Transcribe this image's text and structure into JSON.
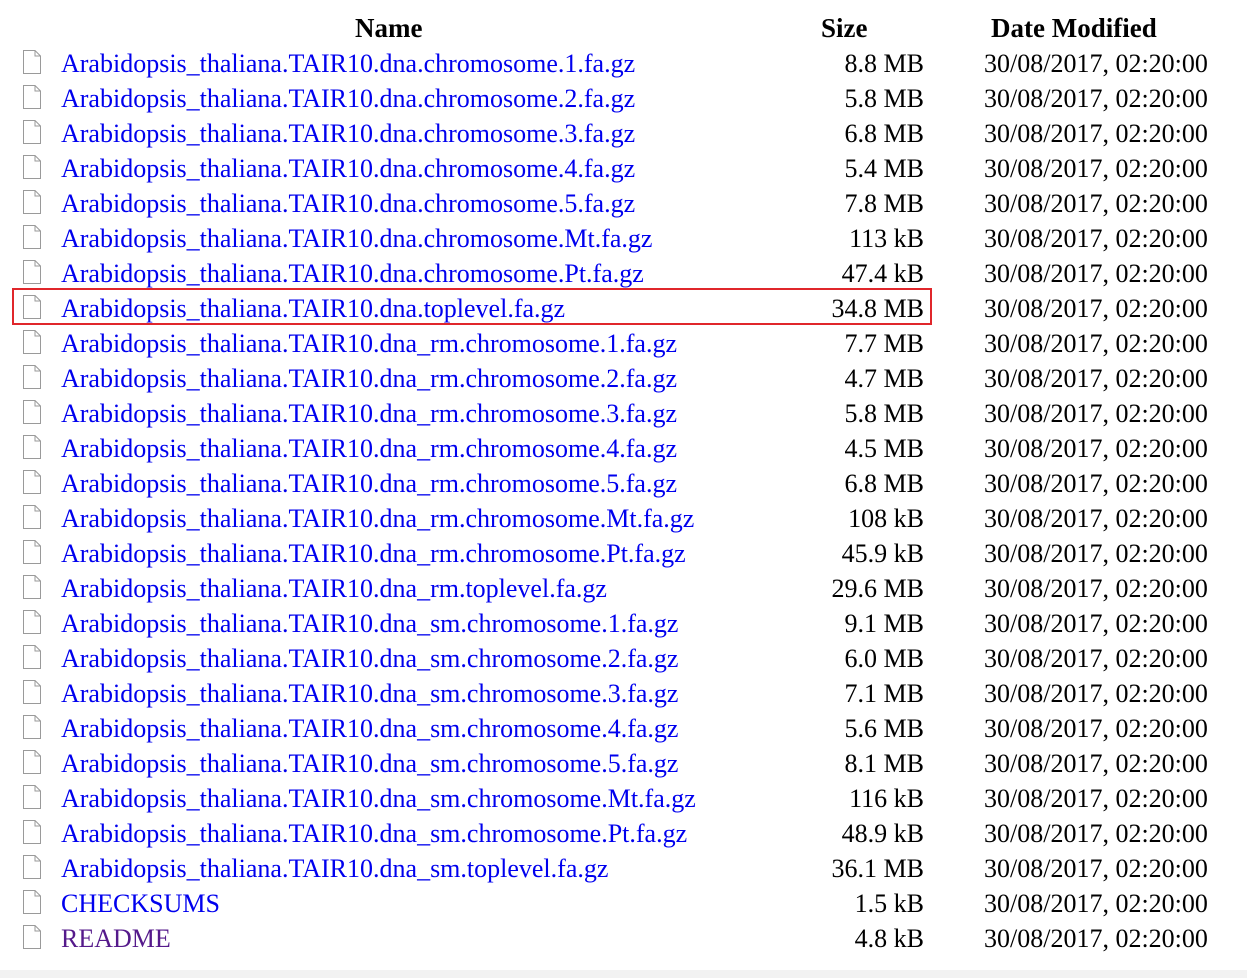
{
  "columns": {
    "name": "Name",
    "size": "Size",
    "date": "Date Modified"
  },
  "files": [
    {
      "name": "Arabidopsis_thaliana.TAIR10.dna.chromosome.1.fa.gz",
      "size": "8.8 MB",
      "date": "30/08/2017, 02:20:00",
      "icon": "file-icon"
    },
    {
      "name": "Arabidopsis_thaliana.TAIR10.dna.chromosome.2.fa.gz",
      "size": "5.8 MB",
      "date": "30/08/2017, 02:20:00",
      "icon": "file-icon"
    },
    {
      "name": "Arabidopsis_thaliana.TAIR10.dna.chromosome.3.fa.gz",
      "size": "6.8 MB",
      "date": "30/08/2017, 02:20:00",
      "icon": "file-icon"
    },
    {
      "name": "Arabidopsis_thaliana.TAIR10.dna.chromosome.4.fa.gz",
      "size": "5.4 MB",
      "date": "30/08/2017, 02:20:00",
      "icon": "file-icon"
    },
    {
      "name": "Arabidopsis_thaliana.TAIR10.dna.chromosome.5.fa.gz",
      "size": "7.8 MB",
      "date": "30/08/2017, 02:20:00",
      "icon": "file-icon"
    },
    {
      "name": "Arabidopsis_thaliana.TAIR10.dna.chromosome.Mt.fa.gz",
      "size": "113 kB",
      "date": "30/08/2017, 02:20:00",
      "icon": "file-icon"
    },
    {
      "name": "Arabidopsis_thaliana.TAIR10.dna.chromosome.Pt.fa.gz",
      "size": "47.4 kB",
      "date": "30/08/2017, 02:20:00",
      "icon": "file-icon"
    },
    {
      "name": "Arabidopsis_thaliana.TAIR10.dna.toplevel.fa.gz",
      "size": "34.8 MB",
      "date": "30/08/2017, 02:20:00",
      "icon": "file-icon",
      "highlighted": true
    },
    {
      "name": "Arabidopsis_thaliana.TAIR10.dna_rm.chromosome.1.fa.gz",
      "size": "7.7 MB",
      "date": "30/08/2017, 02:20:00",
      "icon": "file-icon"
    },
    {
      "name": "Arabidopsis_thaliana.TAIR10.dna_rm.chromosome.2.fa.gz",
      "size": "4.7 MB",
      "date": "30/08/2017, 02:20:00",
      "icon": "file-icon"
    },
    {
      "name": "Arabidopsis_thaliana.TAIR10.dna_rm.chromosome.3.fa.gz",
      "size": "5.8 MB",
      "date": "30/08/2017, 02:20:00",
      "icon": "file-icon"
    },
    {
      "name": "Arabidopsis_thaliana.TAIR10.dna_rm.chromosome.4.fa.gz",
      "size": "4.5 MB",
      "date": "30/08/2017, 02:20:00",
      "icon": "file-icon"
    },
    {
      "name": "Arabidopsis_thaliana.TAIR10.dna_rm.chromosome.5.fa.gz",
      "size": "6.8 MB",
      "date": "30/08/2017, 02:20:00",
      "icon": "file-icon"
    },
    {
      "name": "Arabidopsis_thaliana.TAIR10.dna_rm.chromosome.Mt.fa.gz",
      "size": "108 kB",
      "date": "30/08/2017, 02:20:00",
      "icon": "file-icon"
    },
    {
      "name": "Arabidopsis_thaliana.TAIR10.dna_rm.chromosome.Pt.fa.gz",
      "size": "45.9 kB",
      "date": "30/08/2017, 02:20:00",
      "icon": "file-icon"
    },
    {
      "name": "Arabidopsis_thaliana.TAIR10.dna_rm.toplevel.fa.gz",
      "size": "29.6 MB",
      "date": "30/08/2017, 02:20:00",
      "icon": "file-icon"
    },
    {
      "name": "Arabidopsis_thaliana.TAIR10.dna_sm.chromosome.1.fa.gz",
      "size": "9.1 MB",
      "date": "30/08/2017, 02:20:00",
      "icon": "file-icon"
    },
    {
      "name": "Arabidopsis_thaliana.TAIR10.dna_sm.chromosome.2.fa.gz",
      "size": "6.0 MB",
      "date": "30/08/2017, 02:20:00",
      "icon": "file-icon"
    },
    {
      "name": "Arabidopsis_thaliana.TAIR10.dna_sm.chromosome.3.fa.gz",
      "size": "7.1 MB",
      "date": "30/08/2017, 02:20:00",
      "icon": "file-icon"
    },
    {
      "name": "Arabidopsis_thaliana.TAIR10.dna_sm.chromosome.4.fa.gz",
      "size": "5.6 MB",
      "date": "30/08/2017, 02:20:00",
      "icon": "file-icon"
    },
    {
      "name": "Arabidopsis_thaliana.TAIR10.dna_sm.chromosome.5.fa.gz",
      "size": "8.1 MB",
      "date": "30/08/2017, 02:20:00",
      "icon": "file-icon"
    },
    {
      "name": "Arabidopsis_thaliana.TAIR10.dna_sm.chromosome.Mt.fa.gz",
      "size": "116 kB",
      "date": "30/08/2017, 02:20:00",
      "icon": "file-icon"
    },
    {
      "name": "Arabidopsis_thaliana.TAIR10.dna_sm.chromosome.Pt.fa.gz",
      "size": "48.9 kB",
      "date": "30/08/2017, 02:20:00",
      "icon": "file-icon"
    },
    {
      "name": "Arabidopsis_thaliana.TAIR10.dna_sm.toplevel.fa.gz",
      "size": "36.1 MB",
      "date": "30/08/2017, 02:20:00",
      "icon": "file-icon"
    },
    {
      "name": "CHECKSUMS",
      "size": "1.5 kB",
      "date": "30/08/2017, 02:20:00",
      "icon": "file-icon"
    },
    {
      "name": "README",
      "size": "4.8 kB",
      "date": "30/08/2017, 02:20:00",
      "icon": "file-icon",
      "visited": true
    }
  ],
  "colors": {
    "link": "#0000ee",
    "visited_link": "#551a8b",
    "highlight_border": "#e0262b",
    "icon_stroke": "#9a9a9a"
  }
}
